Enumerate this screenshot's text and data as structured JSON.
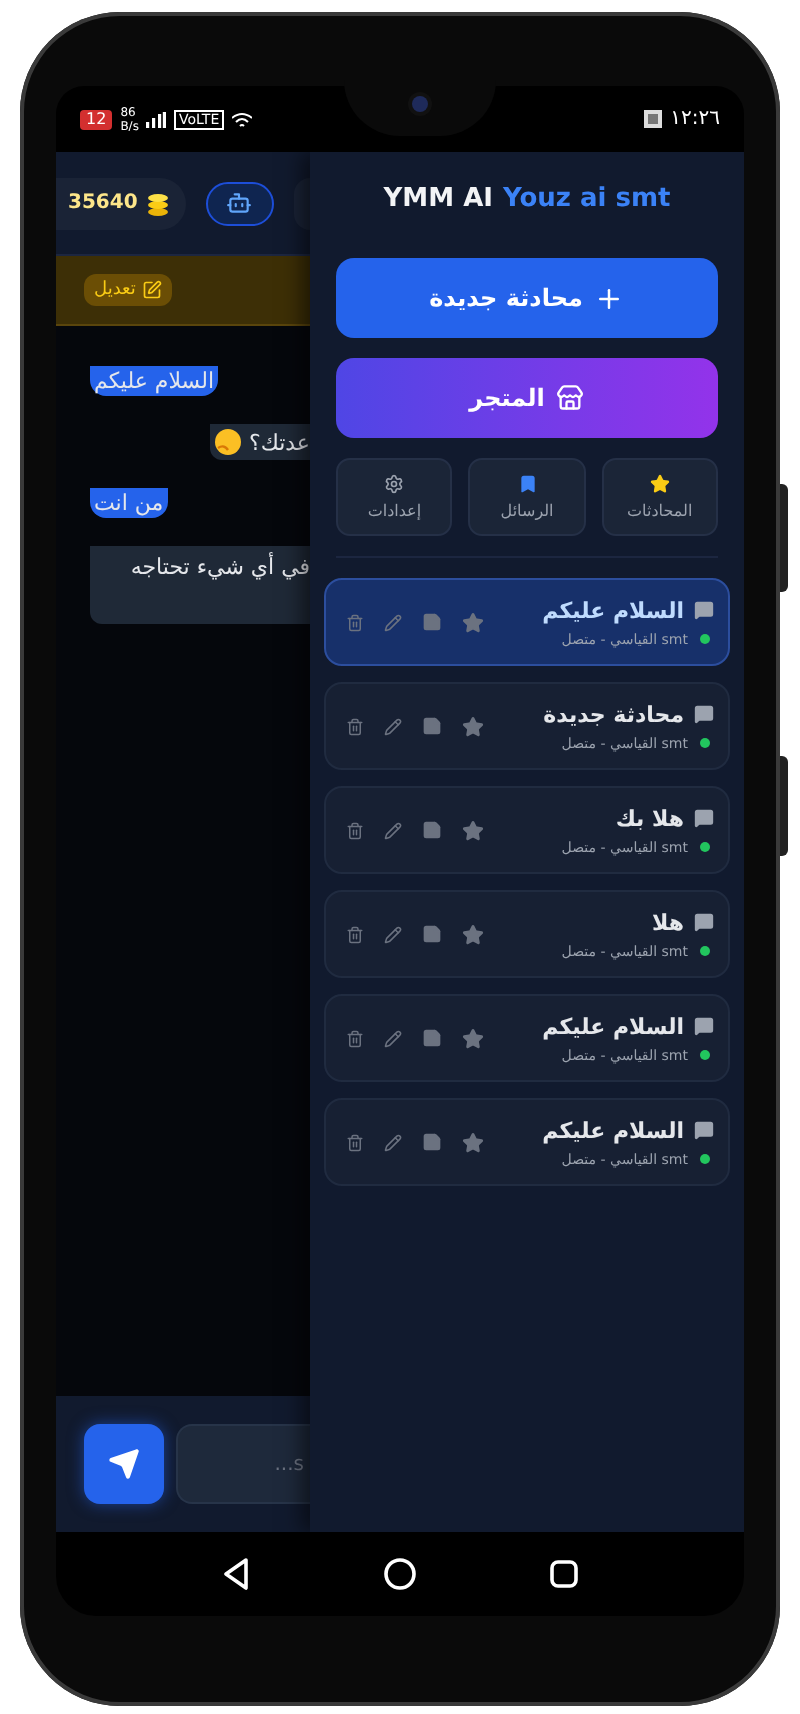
{
  "status_bar": {
    "battery": "12",
    "speed": "86",
    "speed_unit": "B/s",
    "network": "VoLTE",
    "time": "١٢:٢٦"
  },
  "chat": {
    "coins": "35640",
    "edit_button": "تعديل",
    "messages": [
      {
        "kind": "user",
        "text": "السلام عليكم"
      },
      {
        "kind": "bot",
        "text": "عدتك؟",
        "emoji": true
      },
      {
        "kind": "user",
        "text": "من انت"
      },
      {
        "kind": "bot",
        "text": "في أي شيء تحتاجه",
        "emoji": false
      }
    ],
    "input": {
      "placeholder": "...s"
    }
  },
  "drawer": {
    "brand": "YMM AI",
    "subtitle": "Youz ai smt",
    "new_chat": "محادثة جديدة",
    "store": "المتجر",
    "tiles": [
      {
        "label": "المحادثات",
        "kind": "star"
      },
      {
        "label": "الرسائل",
        "kind": "bookmark"
      },
      {
        "label": "إعدادات",
        "kind": "gear"
      }
    ],
    "conversations": [
      {
        "title": "السلام عليكم",
        "meta": "smt القياسي - متصل",
        "selected": true
      },
      {
        "title": "محادثة جديدة",
        "meta": "smt القياسي - متصل",
        "selected": false
      },
      {
        "title": "هلا بك",
        "meta": "smt القياسي - متصل",
        "selected": false
      },
      {
        "title": "هلا",
        "meta": "smt القياسي - متصل",
        "selected": false
      },
      {
        "title": "السلام عليكم",
        "meta": "smt القياسي - متصل",
        "selected": false
      },
      {
        "title": "السلام عليكم",
        "meta": "smt القياسي - متصل",
        "selected": false
      }
    ]
  }
}
